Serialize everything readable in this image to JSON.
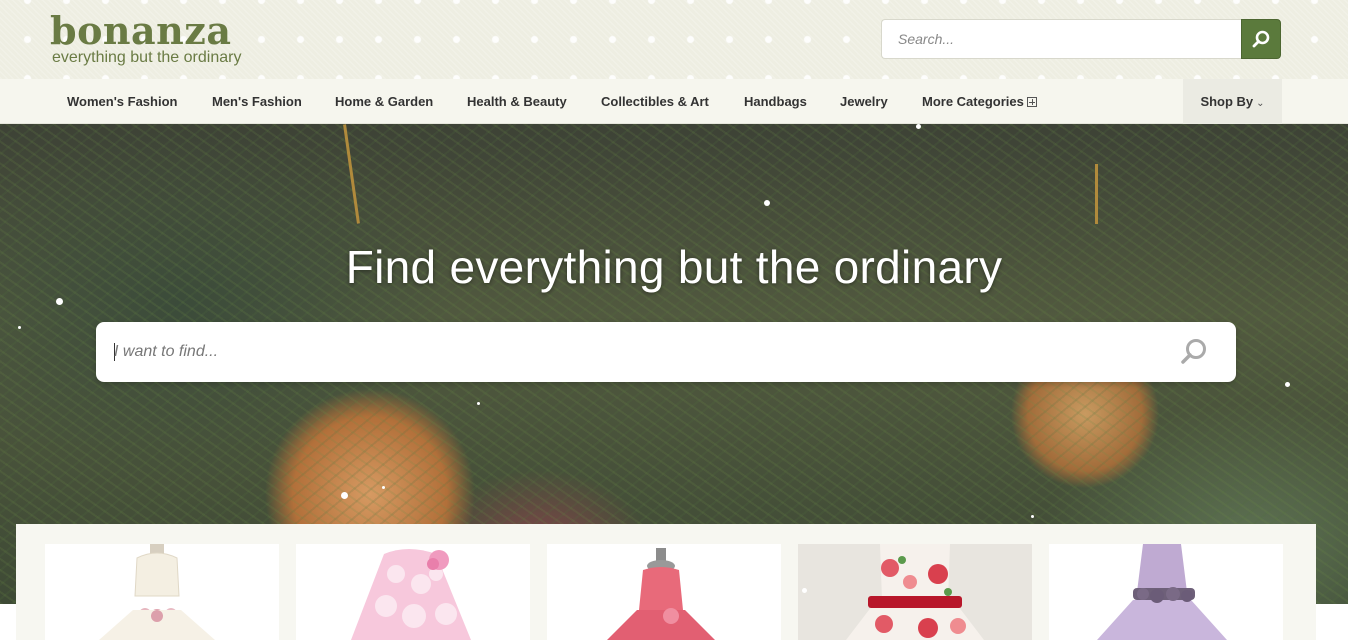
{
  "header": {
    "logo_word": "bonanza",
    "logo_tagline": "everything but the ordinary",
    "search_placeholder": "Search..."
  },
  "nav": {
    "items": [
      {
        "label": "Women's Fashion"
      },
      {
        "label": "Men's Fashion"
      },
      {
        "label": "Home & Garden"
      },
      {
        "label": "Health & Beauty"
      },
      {
        "label": "Collectibles & Art"
      },
      {
        "label": "Handbags"
      },
      {
        "label": "Jewelry"
      },
      {
        "label": "More Categories"
      }
    ],
    "shop_by": "Shop By"
  },
  "hero": {
    "title": "Find everything but the ordinary",
    "search_placeholder": "I want to find..."
  },
  "colors": {
    "brand_green": "#6a7b44",
    "search_button": "#5b7a3c",
    "nav_background": "#f6f6ee"
  },
  "icons": {
    "search": "search-icon",
    "more_categories": "plus-square-icon",
    "shop_by": "chevron-down-icon"
  },
  "products": [
    {
      "description": "white dress with pink flower sash"
    },
    {
      "description": "pink polka dot dress"
    },
    {
      "description": "coral pink dress"
    },
    {
      "description": "white dress with red roses"
    },
    {
      "description": "lavender dress with purple flowers"
    }
  ]
}
